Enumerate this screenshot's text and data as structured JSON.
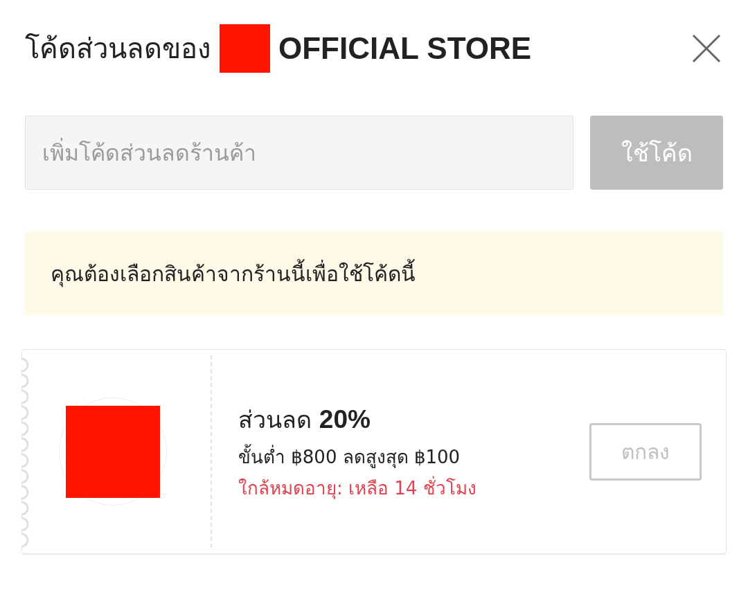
{
  "header": {
    "title": "โค้ดส่วนลดของ",
    "store_name": "OFFICIAL STORE"
  },
  "code_entry": {
    "placeholder": "เพิ่มโค้ดส่วนลดร้านค้า",
    "apply_button": {
      "label": "ใช้โค้ด",
      "disabled": true
    }
  },
  "notice": "คุณต้องเลือกสินค้าจากร้านนี้เพื่อใช้โค้ดนี้",
  "vouchers": [
    {
      "title": "ส่วนลด **20%**",
      "condition": "ขั้นต่ำ ฿800 ลดสูงสุด ฿100",
      "expiry": "ใกล้หมดอายุ: เหลือ 14 ชั่วโมง",
      "button": {
        "label": "ตกลง",
        "disabled": true
      }
    }
  ]
}
